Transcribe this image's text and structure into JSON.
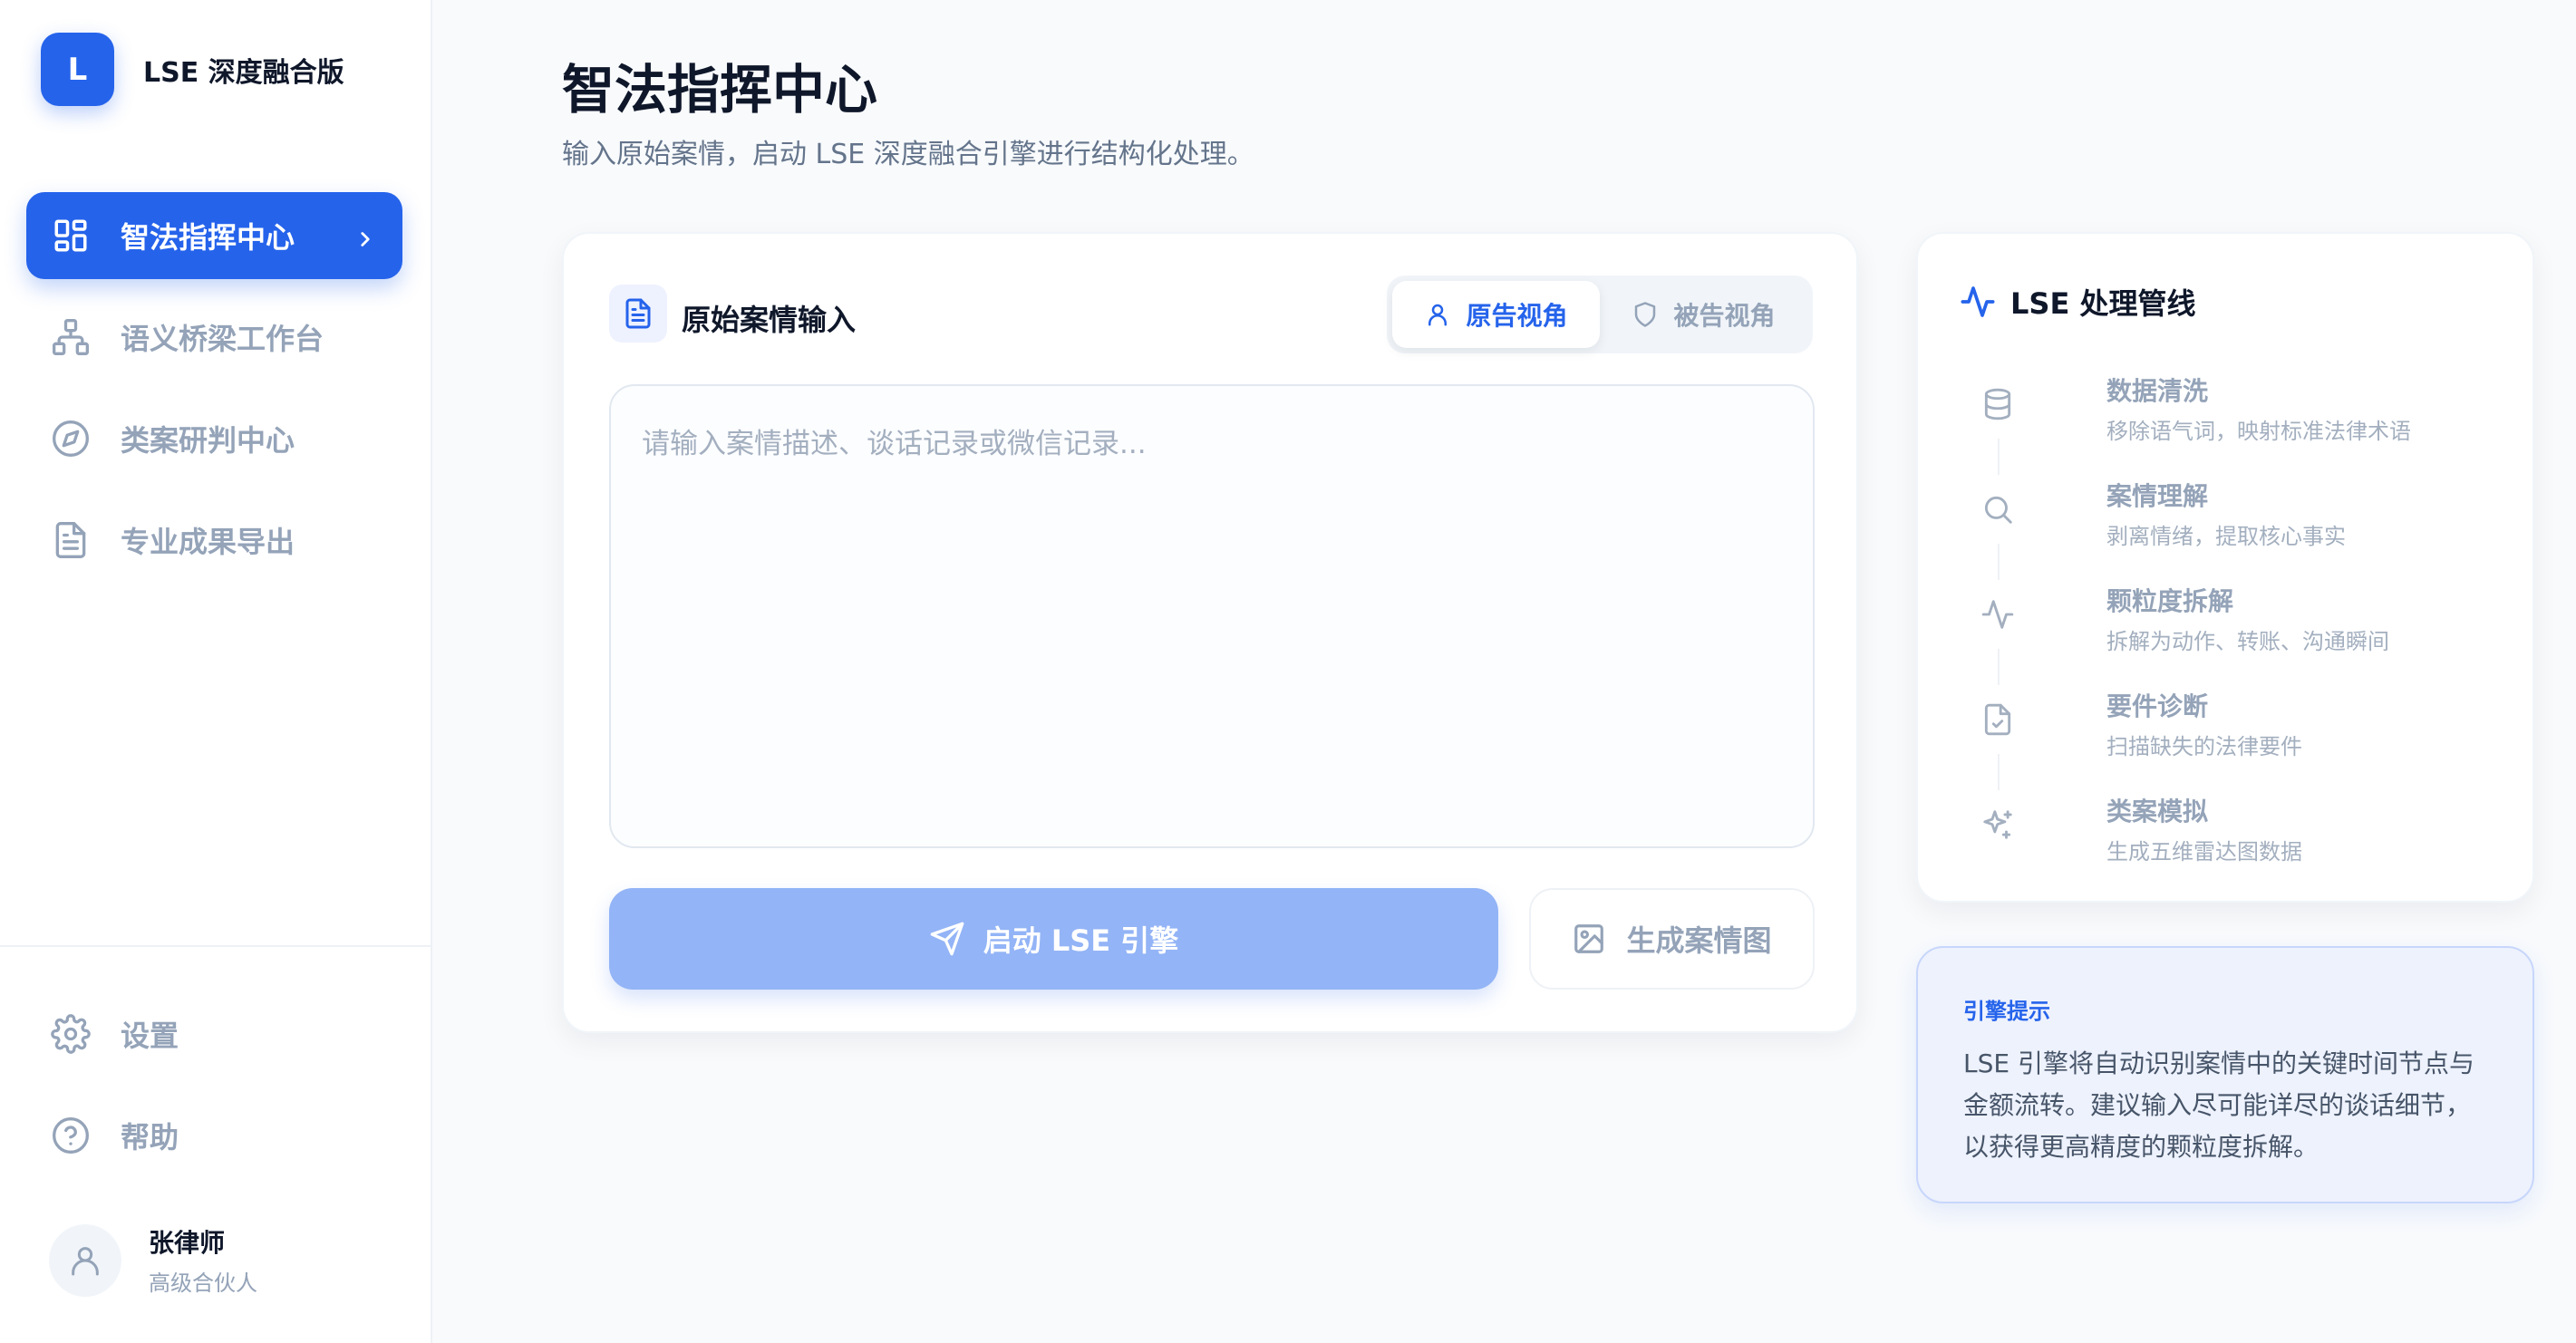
{
  "brand": {
    "logo_letter": "L",
    "name": "LSE 深度融合版"
  },
  "sidebar": {
    "nav": [
      {
        "label": "智法指挥中心",
        "icon": "grid-icon",
        "active": true
      },
      {
        "label": "语义桥梁工作台",
        "icon": "sitemap-icon",
        "active": false
      },
      {
        "label": "类案研判中心",
        "icon": "compass-icon",
        "active": false
      },
      {
        "label": "专业成果导出",
        "icon": "file-text-icon",
        "active": false
      }
    ],
    "bottom": [
      {
        "label": "设置",
        "icon": "gear-icon"
      },
      {
        "label": "帮助",
        "icon": "help-circle-icon"
      }
    ],
    "profile": {
      "name": "张律师",
      "role": "高级合伙人"
    }
  },
  "header": {
    "title": "智法指挥中心",
    "subtitle": "输入原始案情，启动 LSE 深度融合引擎进行结构化处理。"
  },
  "input_card": {
    "title": "原始案情输入",
    "tabs": [
      {
        "label": "原告视角",
        "icon": "user-icon",
        "active": true
      },
      {
        "label": "被告视角",
        "icon": "shield-icon",
        "active": false
      }
    ],
    "textarea_value": "",
    "textarea_placeholder": "请输入案情描述、谈话记录或微信记录...",
    "start_button": "启动 LSE 引擎",
    "generate_button": "生成案情图"
  },
  "pipeline": {
    "title": "LSE 处理管线",
    "steps": [
      {
        "title": "数据清洗",
        "desc": "移除语气词，映射标准法律术语",
        "icon": "database-icon"
      },
      {
        "title": "案情理解",
        "desc": "剥离情绪，提取核心事实",
        "icon": "search-icon"
      },
      {
        "title": "颗粒度拆解",
        "desc": "拆解为动作、转账、沟通瞬间",
        "icon": "activity-icon"
      },
      {
        "title": "要件诊断",
        "desc": "扫描缺失的法律要件",
        "icon": "file-check-icon"
      },
      {
        "title": "类案模拟",
        "desc": "生成五维雷达图数据",
        "icon": "sparkles-icon"
      }
    ]
  },
  "tip": {
    "title": "引擎提示",
    "body": "LSE 引擎将自动识别案情中的关键时间节点与金额流转。建议输入尽可能详尽的谈话细节，以获得更高精度的颗粒度拆解。"
  },
  "colors": {
    "accent": "#2563eb",
    "accent_light": "#93b4f6",
    "muted": "#94a3b8"
  }
}
